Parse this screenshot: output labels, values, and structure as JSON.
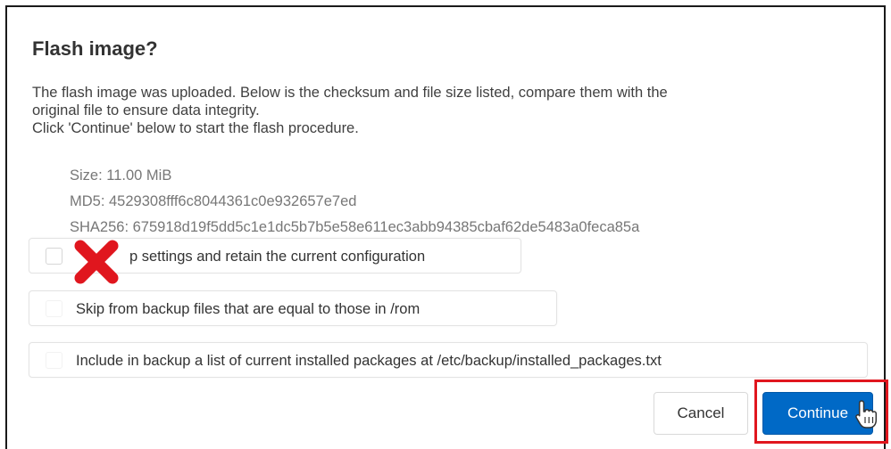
{
  "dialog": {
    "title": "Flash image?",
    "description": [
      "The flash image was uploaded. Below is the checksum and file size listed, compare them with the",
      "original file to ensure data integrity.",
      "Click 'Continue' below to start the flash procedure."
    ],
    "file_info": {
      "size": "Size: 11.00 MiB",
      "md5": "MD5: 4529308fff6c8044361c0e932657e7ed",
      "sha256": "SHA256: 675918d19f5dd5c1e1dc5b7b5e58e611ec3abb94385cbaf62de5483a0feca85a"
    },
    "options": [
      {
        "label": "p settings and retain the current configuration",
        "checked": false,
        "icon": "red-x-mark-icon"
      },
      {
        "label": "Skip from backup files that are equal to those in /rom",
        "checked": false
      },
      {
        "label": "Include in backup a list of current installed packages at /etc/backup/installed_packages.txt",
        "checked": false
      }
    ],
    "buttons": {
      "cancel": "Cancel",
      "continue": "Continue"
    }
  },
  "colors": {
    "primary_button": "#0069c6",
    "highlight_border": "#e0161e",
    "annotation_x": "#e0161e"
  },
  "icons": {
    "annotation": "red-x-mark-icon",
    "pointer": "hand-pointer-cursor-icon"
  }
}
